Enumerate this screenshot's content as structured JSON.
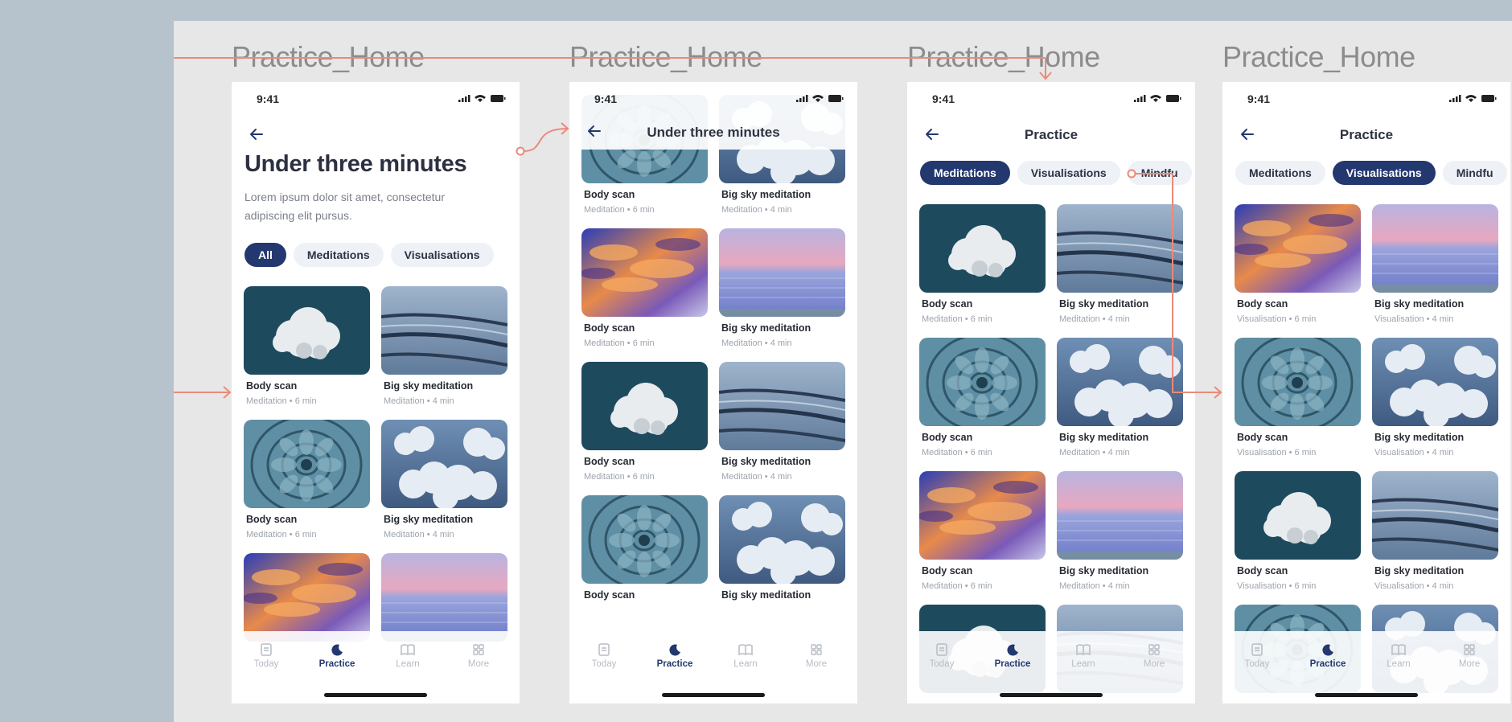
{
  "frames": [
    {
      "label": "Practice_Home",
      "time": "9:41",
      "large_title": "Under three minutes",
      "description": "Lorem ipsum dolor sit amet, consectetur adipiscing elit pursus.",
      "chips": [
        "All",
        "Meditations",
        "Visualisations"
      ],
      "active_chip": 0,
      "cards": [
        {
          "title": "Body scan",
          "subtitle": "Meditation • 6 min",
          "image": "cloud-dark"
        },
        {
          "title": "Big sky meditation",
          "subtitle": "Meditation • 4 min",
          "image": "water-waves"
        },
        {
          "title": "Body scan",
          "subtitle": "Meditation • 6 min",
          "image": "succulent"
        },
        {
          "title": "Big sky meditation",
          "subtitle": "Meditation • 4 min",
          "image": "sky-clouds"
        },
        {
          "title": "",
          "subtitle": "",
          "image": "sunset"
        },
        {
          "title": "",
          "subtitle": "",
          "image": "sea-pink"
        }
      ]
    },
    {
      "label": "Practice_Home",
      "time": "9:41",
      "nav_title": "Under three minutes",
      "cards": [
        {
          "title": "Body scan",
          "subtitle": "Meditation • 6 min",
          "image": "succulent"
        },
        {
          "title": "Big sky meditation",
          "subtitle": "Meditation • 4 min",
          "image": "sky-clouds"
        },
        {
          "title": "Body scan",
          "subtitle": "Meditation • 6 min",
          "image": "sunset"
        },
        {
          "title": "Big sky meditation",
          "subtitle": "Meditation • 4 min",
          "image": "sea-pink"
        },
        {
          "title": "Body scan",
          "subtitle": "Meditation • 6 min",
          "image": "cloud-dark"
        },
        {
          "title": "Big sky meditation",
          "subtitle": "Meditation • 4 min",
          "image": "water-waves"
        },
        {
          "title": "Body scan",
          "subtitle": "",
          "image": "succulent"
        },
        {
          "title": "Big sky meditation",
          "subtitle": "",
          "image": "sky-clouds"
        }
      ]
    },
    {
      "label": "Practice_Home",
      "time": "9:41",
      "nav_title": "Practice",
      "chips": [
        "Meditations",
        "Visualisations",
        "Mindfu"
      ],
      "active_chip": 0,
      "cards": [
        {
          "title": "Body scan",
          "subtitle": "Meditation • 6 min",
          "image": "cloud-dark"
        },
        {
          "title": "Big sky meditation",
          "subtitle": "Meditation • 4 min",
          "image": "water-waves"
        },
        {
          "title": "Body scan",
          "subtitle": "Meditation • 6 min",
          "image": "succulent"
        },
        {
          "title": "Big sky meditation",
          "subtitle": "Meditation • 4 min",
          "image": "sky-clouds"
        },
        {
          "title": "Body scan",
          "subtitle": "Meditation • 6 min",
          "image": "sunset"
        },
        {
          "title": "Big sky meditation",
          "subtitle": "Meditation • 4 min",
          "image": "sea-pink"
        },
        {
          "title": "",
          "subtitle": "",
          "image": "cloud-dark"
        },
        {
          "title": "",
          "subtitle": "",
          "image": "water-waves"
        }
      ]
    },
    {
      "label": "Practice_Home",
      "time": "9:41",
      "nav_title": "Practice",
      "chips": [
        "Meditations",
        "Visualisations",
        "Mindfu"
      ],
      "active_chip": 1,
      "cards": [
        {
          "title": "Body scan",
          "subtitle": "Visualisation • 6 min",
          "image": "sunset"
        },
        {
          "title": "Big sky meditation",
          "subtitle": "Visualisation • 4 min",
          "image": "sea-pink"
        },
        {
          "title": "Body scan",
          "subtitle": "Visualisation • 6 min",
          "image": "succulent"
        },
        {
          "title": "Big sky meditation",
          "subtitle": "Visualisation • 4 min",
          "image": "sky-clouds"
        },
        {
          "title": "Body scan",
          "subtitle": "Visualisation • 6 min",
          "image": "cloud-dark"
        },
        {
          "title": "Big sky meditation",
          "subtitle": "Visualisation • 4 min",
          "image": "water-waves"
        },
        {
          "title": "",
          "subtitle": "",
          "image": "succulent"
        },
        {
          "title": "",
          "subtitle": "",
          "image": "sky-clouds"
        }
      ]
    }
  ],
  "tabbar": [
    {
      "label": "Today",
      "icon": "notes-icon"
    },
    {
      "label": "Practice",
      "icon": "moon-icon"
    },
    {
      "label": "Learn",
      "icon": "book-icon"
    },
    {
      "label": "More",
      "icon": "grid-icon"
    }
  ],
  "active_tab": 1,
  "colors": {
    "accent": "#23386f",
    "connector": "#ea8a7a",
    "canvas": "#e7e7e8",
    "outer": "#b6c3cd"
  }
}
